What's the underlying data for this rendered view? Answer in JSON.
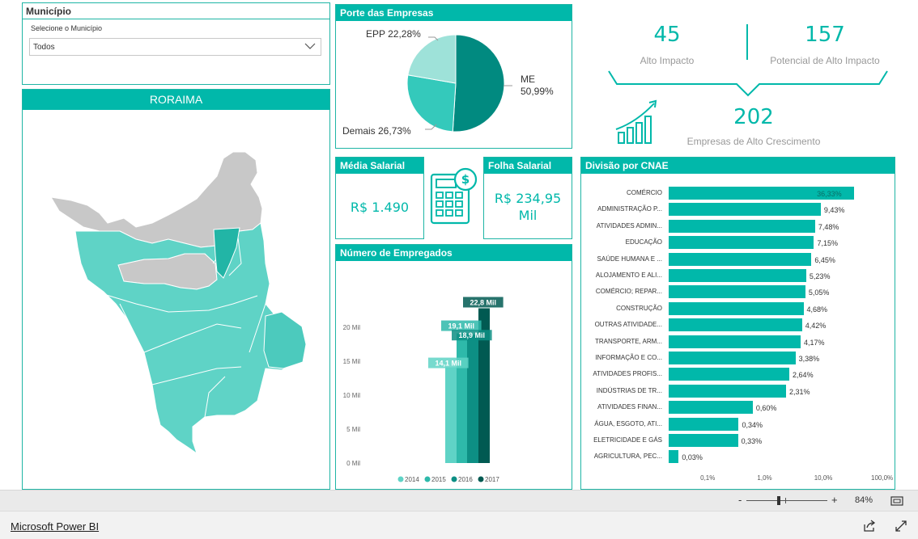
{
  "municipio": {
    "title": "Município",
    "label": "Selecione o Município",
    "selected": "Todos"
  },
  "map": {
    "title": "RORAIMA"
  },
  "porte": {
    "title": "Porte das Empresas",
    "slices": [
      {
        "label": "ME",
        "value": 50.99,
        "text": "50,99%",
        "color": "#018a80"
      },
      {
        "label": "Demais",
        "value": 26.73,
        "text": "26,73%",
        "color": "#34c9bb"
      },
      {
        "label": "EPP",
        "value": 22.28,
        "text": "22,28%",
        "color": "#9ee2d9"
      }
    ],
    "epp_label": "EPP 22,28%",
    "me_label_1": "ME",
    "me_label_2": "50,99%",
    "demais_label": "Demais 26,73%"
  },
  "kpi": {
    "alto_impacto_value": "45",
    "alto_impacto_label": "Alto Impacto",
    "potencial_value": "157",
    "potencial_label": "Potencial de Alto Impacto",
    "crescimento_value": "202",
    "crescimento_label": "Empresas de Alto Crescimento"
  },
  "media_salarial": {
    "title": "Média Salarial",
    "value": "R$ 1.490"
  },
  "folha_salarial": {
    "title": "Folha Salarial",
    "value_line1": "R$ 234,95",
    "value_line2": "Mil"
  },
  "empregados": {
    "title": "Número de Empregados"
  },
  "cnae": {
    "title": "Divisão por CNAE",
    "x_ticks": [
      "0,1%",
      "1,0%",
      "10,0%",
      "100,0%"
    ]
  },
  "chart_data": [
    {
      "type": "bar",
      "title": "Número de Empregados",
      "categories": [
        "2014",
        "2015",
        "2016",
        "2017"
      ],
      "values": [
        14100,
        19100,
        18900,
        22800
      ],
      "data_labels": [
        "14,1 Mil",
        "19,1 Mil",
        "18,9 Mil",
        "22,8 Mil"
      ],
      "colors": [
        "#5fd3c6",
        "#2eb9aa",
        "#0d8f84",
        "#015a52"
      ],
      "yticks": [
        "0 Mil",
        "5 Mil",
        "10 Mil",
        "15 Mil",
        "20 Mil"
      ],
      "ylim": [
        0,
        25000
      ],
      "legend": "bottom"
    },
    {
      "type": "bar",
      "title": "Divisão por CNAE",
      "orientation": "horizontal",
      "xscale": "log",
      "categories": [
        "COMÉRCIO",
        "ADMINISTRAÇÃO P...",
        "ATIVIDADES ADMIN...",
        "EDUCAÇÃO",
        "SAÚDE HUMANA E ...",
        "ALOJAMENTO E ALI...",
        "COMÉRCIO; REPAR...",
        "CONSTRUÇÃO",
        "OUTRAS ATIVIDADE...",
        "TRANSPORTE, ARM...",
        "INFORMAÇÃO E CO...",
        "ATIVIDADES PROFIS...",
        "INDÚSTRIAS DE TR...",
        "ATIVIDADES FINAN...",
        "ÁGUA, ESGOTO, ATI...",
        "ELETRICIDADE E GÁS",
        "AGRICULTURA, PEC..."
      ],
      "values": [
        36.33,
        9.43,
        7.48,
        7.15,
        6.45,
        5.23,
        5.05,
        4.68,
        4.42,
        4.17,
        3.38,
        2.64,
        2.31,
        0.6,
        0.34,
        0.33,
        0.03
      ],
      "data_labels": [
        "36,33%",
        "9,43%",
        "7,48%",
        "7,15%",
        "6,45%",
        "5,23%",
        "5,05%",
        "4,68%",
        "4,42%",
        "4,17%",
        "3,38%",
        "2,64%",
        "2,31%",
        "0,60%",
        "0,34%",
        "0,33%",
        "0,03%"
      ],
      "xlim": [
        0.02,
        100
      ]
    }
  ],
  "status": {
    "zoom": "84%",
    "minus": "-",
    "plus": "+"
  },
  "footer": {
    "brand": "Microsoft Power BI"
  }
}
